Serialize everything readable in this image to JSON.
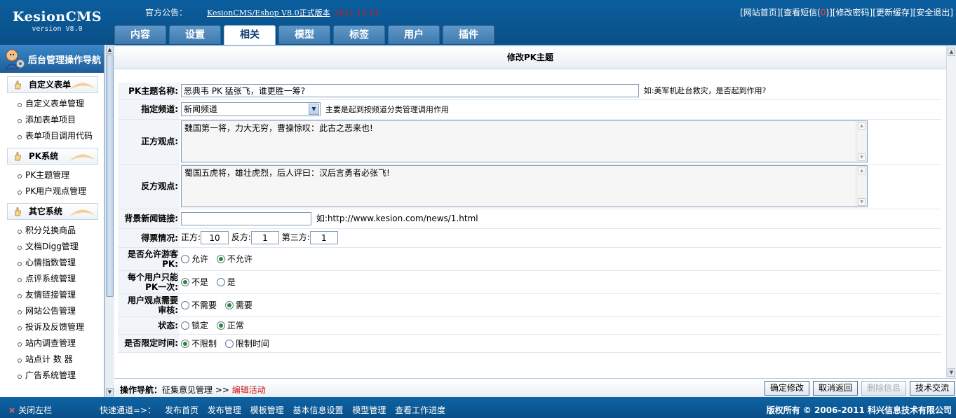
{
  "header": {
    "logo_name": "KesionCMS",
    "logo_version": "version V8.0",
    "notice_label": "官方公告：",
    "notice_link": "KesionCMS/Eshop V8.0正式版本",
    "notice_date": "2011-10-10",
    "links": [
      "[网站首页]",
      "[查看短信(",
      "0",
      ")]",
      "[修改密码]",
      "[更新缓存]",
      "[安全退出]"
    ]
  },
  "tabs": [
    {
      "label": "内容"
    },
    {
      "label": "设置"
    },
    {
      "label": "相关",
      "active": true
    },
    {
      "label": "模型"
    },
    {
      "label": "标签"
    },
    {
      "label": "用户"
    },
    {
      "label": "插件"
    }
  ],
  "sidebar": {
    "title": "后台管理操作导航",
    "groups": [
      {
        "title": "自定义表单",
        "items": [
          "自定义表单管理",
          "添加表单项目",
          "表单项目调用代码"
        ]
      },
      {
        "title": "PK系统",
        "items": [
          "PK主题管理",
          "PK用户观点管理"
        ]
      },
      {
        "title": "其它系统",
        "items": [
          "积分兑换商品",
          "文档Digg管理",
          "心情指数管理",
          "点评系统管理",
          "友情链接管理",
          "网站公告管理",
          "投诉及反馈管理",
          "站内调查管理",
          "站点计 数 器",
          "广告系统管理"
        ]
      }
    ]
  },
  "page": {
    "title": "修改PK主题"
  },
  "form": {
    "name_label": "PK主题名称:",
    "name_value": "恶典韦 PK 猛张飞，谁更胜一筹?",
    "name_hint": "如:美军机赴台救灾，是否起到作用?",
    "channel_label": "指定频道:",
    "channel_value": "新闻频道",
    "channel_hint": "主要是起到按频道分类管理调用作用",
    "pro_label": "正方观点:",
    "pro_value": "魏国第一将，力大无穷，曹操惊叹：此古之恶来也!",
    "con_label": "反方观点:",
    "con_value": "蜀国五虎将，雄壮虎烈，后人评曰：汉后言勇者必张飞!",
    "news_label": "背景新闻链接:",
    "news_value": "",
    "news_hint": "如:http://www.kesion.com/news/1.html",
    "votes_label": "得票情况:",
    "votes_pro_label": "正方:",
    "votes_pro": "10",
    "votes_con_label": "反方:",
    "votes_con": "1",
    "votes_third_label": "第三方:",
    "votes_third": "1",
    "guest_label_1": "是否允许游客",
    "guest_label_2": "PK:",
    "guest_opt_1": "允许",
    "guest_opt_2": "不允许",
    "once_label_1": "每个用户只能",
    "once_label_2": "PK一次:",
    "once_opt_1": "不是",
    "once_opt_2": "是",
    "audit_label_1": "用户观点需要",
    "audit_label_2": "审核:",
    "audit_opt_1": "不需要",
    "audit_opt_2": "需要",
    "status_label": "状态:",
    "status_opt_1": "锁定",
    "status_opt_2": "正常",
    "time_label": "是否限定时间:",
    "time_opt_1": "不限制",
    "time_opt_2": "限制时间"
  },
  "opbar": {
    "nav_label": "操作导航：",
    "nav_path": "征集意见管理",
    "nav_sep": ">>",
    "nav_current": "编辑活动",
    "buttons": [
      "确定修改",
      "取消返回",
      "删除信息",
      "技术交流"
    ]
  },
  "footer": {
    "close_x": "×",
    "close_label": "关闭左栏",
    "quick_label": "快速通道=>：",
    "quick_links": [
      "发布首页",
      "发布管理",
      "模板管理",
      "基本信息设置",
      "模型管理",
      "查看工作进度"
    ],
    "copyright": "版权所有 © 2006-2011 科兴信息技术有限公司"
  },
  "colors": {
    "header_bg": "#0b5e9e",
    "accent_red": "#cc1111",
    "radio_checked": "#2a8a2a"
  }
}
